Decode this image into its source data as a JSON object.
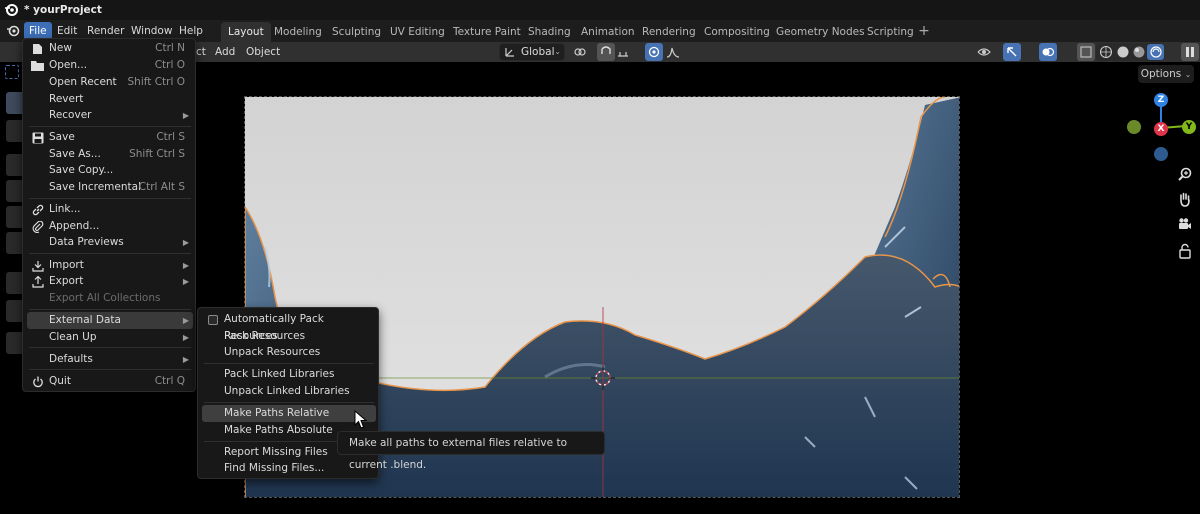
{
  "app": {
    "title": "* yourProject"
  },
  "menubar": {
    "items": [
      "File",
      "Edit",
      "Render",
      "Window",
      "Help"
    ],
    "active": "File"
  },
  "workspaces": {
    "tabs": [
      "Layout",
      "Modeling",
      "Sculpting",
      "UV Editing",
      "Texture Paint",
      "Shading",
      "Animation",
      "Rendering",
      "Compositing",
      "Geometry Nodes",
      "Scripting"
    ],
    "active": "Layout",
    "add_label": "+"
  },
  "header": {
    "object_menu_partial": "ct",
    "add_label": "Add",
    "object_label": "Object",
    "transform_orientation": "Global",
    "options_label": "Options"
  },
  "file_menu": {
    "new": {
      "label": "New",
      "shortcut": "Ctrl N"
    },
    "open": {
      "label": "Open...",
      "shortcut": "Ctrl O"
    },
    "open_recent": {
      "label": "Open Recent",
      "shortcut": "Shift Ctrl O"
    },
    "revert": {
      "label": "Revert"
    },
    "recover": {
      "label": "Recover"
    },
    "save": {
      "label": "Save",
      "shortcut": "Ctrl S"
    },
    "save_as": {
      "label": "Save As...",
      "shortcut": "Shift Ctrl S"
    },
    "save_copy": {
      "label": "Save Copy..."
    },
    "save_incremental": {
      "label": "Save Incremental",
      "shortcut": "Ctrl Alt S"
    },
    "link": {
      "label": "Link..."
    },
    "append": {
      "label": "Append..."
    },
    "data_previews": {
      "label": "Data Previews"
    },
    "import": {
      "label": "Import"
    },
    "export": {
      "label": "Export"
    },
    "export_all": {
      "label": "Export All Collections"
    },
    "external_data": {
      "label": "External Data"
    },
    "clean_up": {
      "label": "Clean Up"
    },
    "defaults": {
      "label": "Defaults"
    },
    "quit": {
      "label": "Quit",
      "shortcut": "Ctrl Q"
    }
  },
  "external_data_menu": {
    "auto_pack": {
      "label": "Automatically Pack Resources",
      "checked": false
    },
    "pack_resources": "Pack Resources",
    "unpack_resources": "Unpack Resources",
    "pack_linked": "Pack Linked Libraries",
    "unpack_linked": "Unpack Linked Libraries",
    "make_relative": "Make Paths Relative",
    "make_absolute": "Make Paths Absolute",
    "report_missing": "Report Missing Files",
    "find_missing": "Find Missing Files..."
  },
  "tooltip": {
    "text": "Make all paths to external files relative to current .blend."
  },
  "gizmo": {
    "z_label": "Z",
    "y_label": "Y",
    "x_label": "X",
    "x_color": "#e0344b",
    "y_color": "#83b81a",
    "z_color": "#2f84e3"
  },
  "colors": {
    "accent": "#4772b3",
    "menu_bg": "#181818",
    "render_outline": "#e8954a"
  }
}
